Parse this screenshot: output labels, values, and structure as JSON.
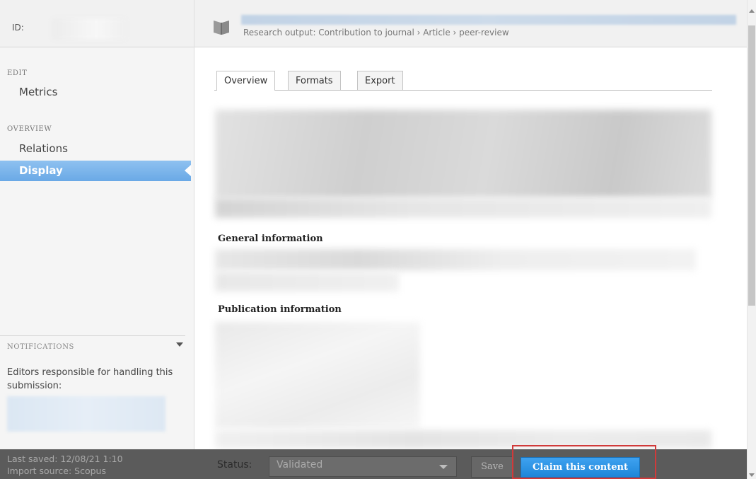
{
  "header": {
    "id_label": "ID:",
    "breadcrumb": "Research output: Contribution to journal › Article › peer-review"
  },
  "sidebar": {
    "sections": [
      {
        "title": "EDIT",
        "items": [
          {
            "label": "Metrics",
            "active": false
          }
        ]
      },
      {
        "title": "OVERVIEW",
        "items": [
          {
            "label": "Relations",
            "active": false
          },
          {
            "label": "Display",
            "active": true
          }
        ]
      }
    ],
    "notifications": {
      "title": "NOTIFICATIONS",
      "text": "Editors responsible for handling this submission:"
    }
  },
  "tabs": [
    {
      "label": "Overview",
      "active": true
    },
    {
      "label": "Formats",
      "active": false
    },
    {
      "label": "Export",
      "active": false
    }
  ],
  "content": {
    "general_heading": "General information",
    "publication_heading": "Publication information"
  },
  "footer": {
    "last_saved": "Last saved: 12/08/21 1:10",
    "import_source": "Import source: Scopus",
    "status_label": "Status:",
    "status_value": "Validated",
    "save_label": "Save",
    "claim_label": "Claim this content"
  },
  "colors": {
    "accent_nav": "#7ab4eb",
    "claim_button": "#2f95e6",
    "highlight": "#d13a3a",
    "footer_bg": "#5b5b5b"
  },
  "icons": [
    "book-icon",
    "chevron-down-icon",
    "dropdown-caret-icon",
    "scroll-up-icon",
    "scroll-down-icon"
  ]
}
